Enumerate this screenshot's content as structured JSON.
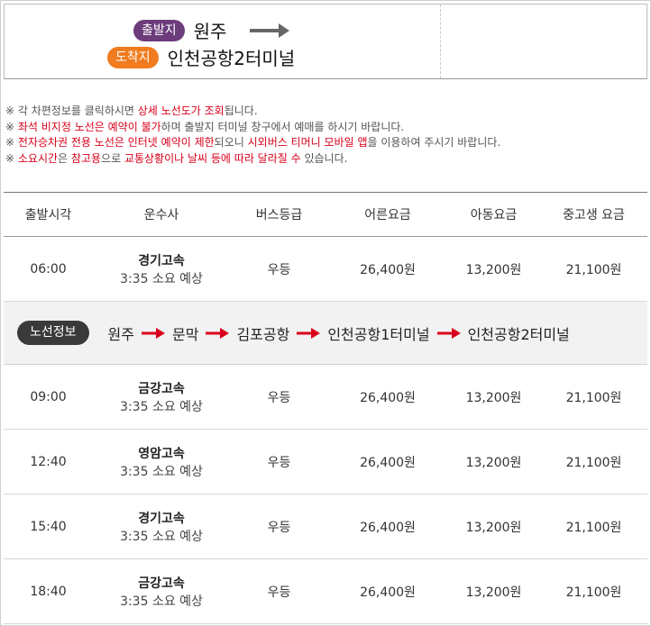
{
  "header": {
    "departure_label": "출발지",
    "departure_place": "원주",
    "arrival_label": "도착지",
    "arrival_place": "인천공항2터미널"
  },
  "notices": [
    {
      "parts": [
        {
          "t": "※ 각 차편정보를 클릭하시면 ",
          "red": false
        },
        {
          "t": "상세 노선도가 조회",
          "red": true
        },
        {
          "t": "됩니다.",
          "red": false
        }
      ]
    },
    {
      "parts": [
        {
          "t": "※ ",
          "red": false
        },
        {
          "t": "좌석 비지정 노선은 예약이 불가",
          "red": true
        },
        {
          "t": "하며 출발지 터미널 창구에서 예매를 하시기 바랍니다.",
          "red": false
        }
      ]
    },
    {
      "parts": [
        {
          "t": "※ ",
          "red": false
        },
        {
          "t": "전자승차권 전용 노선은 인터넷 예약이 제한",
          "red": true
        },
        {
          "t": "되오니 ",
          "red": false
        },
        {
          "t": "시외버스 티머니 모바일 앱",
          "red": true
        },
        {
          "t": "을 이용하여 주시기 바랍니다.",
          "red": false
        }
      ]
    },
    {
      "parts": [
        {
          "t": "※ ",
          "red": false
        },
        {
          "t": "소요시간",
          "red": true
        },
        {
          "t": "은 ",
          "red": false
        },
        {
          "t": "참고용",
          "red": true
        },
        {
          "t": "으로 ",
          "red": false
        },
        {
          "t": "교통상황이나 날씨 등에 따라 달라질 수",
          "red": true
        },
        {
          "t": " 있습니다.",
          "red": false
        }
      ]
    }
  ],
  "table": {
    "headers": [
      "출발시각",
      "운수사",
      "버스등급",
      "어른요금",
      "아동요금",
      "중고생 요금"
    ],
    "rows": [
      {
        "time": "06:00",
        "company": "경기고속",
        "duration": "3:35 소요 예상",
        "grade": "우등",
        "adult": "26,400원",
        "child": "13,200원",
        "student": "21,100원"
      },
      {
        "time": "09:00",
        "company": "금강고속",
        "duration": "3:35 소요 예상",
        "grade": "우등",
        "adult": "26,400원",
        "child": "13,200원",
        "student": "21,100원"
      },
      {
        "time": "12:40",
        "company": "영암고속",
        "duration": "3:35 소요 예상",
        "grade": "우등",
        "adult": "26,400원",
        "child": "13,200원",
        "student": "21,100원"
      },
      {
        "time": "15:40",
        "company": "경기고속",
        "duration": "3:35 소요 예상",
        "grade": "우등",
        "adult": "26,400원",
        "child": "13,200원",
        "student": "21,100원"
      },
      {
        "time": "18:40",
        "company": "금강고속",
        "duration": "3:35 소요 예상",
        "grade": "우등",
        "adult": "26,400원",
        "child": "13,200원",
        "student": "21,100원"
      }
    ]
  },
  "route_info": {
    "label": "노선정보",
    "stops": [
      "원주",
      "문막",
      "김포공항",
      "인천공항1터미널",
      "인천공항2터미널"
    ]
  },
  "colors": {
    "departure_badge": "#6d3c7b",
    "arrival_badge": "#f07c1f",
    "highlight_red": "#d9001b",
    "route_pill": "#3a3a3a"
  }
}
